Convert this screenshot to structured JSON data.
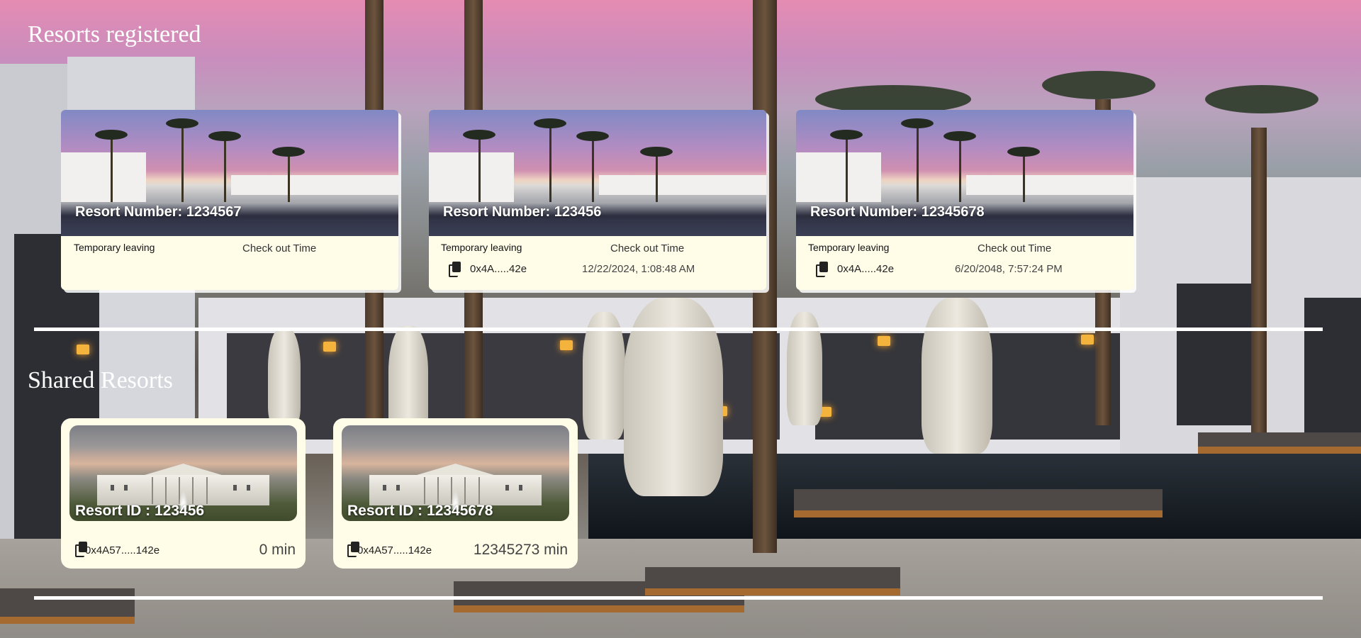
{
  "sections": {
    "registered_title": "Resorts registered",
    "shared_title": "Shared Resorts"
  },
  "registered": [
    {
      "title": "Resort Number: 1234567",
      "leaving_label": "Temporary leaving",
      "checkout_label": "Check out Time",
      "address": "",
      "checkout_time": ""
    },
    {
      "title": "Resort Number: 123456",
      "leaving_label": "Temporary leaving",
      "checkout_label": "Check out Time",
      "address": "0x4A.....42e",
      "checkout_time": "12/22/2024, 1:08:48 AM"
    },
    {
      "title": "Resort Number: 12345678",
      "leaving_label": "Temporary leaving",
      "checkout_label": "Check out Time",
      "address": "0x4A.....42e",
      "checkout_time": "6/20/2048, 7:57:24 PM"
    }
  ],
  "shared": [
    {
      "title": "Resort ID : 123456",
      "address": "0x4A57.....142e",
      "duration": "0 min"
    },
    {
      "title": "Resort ID : 12345678",
      "address": "0x4A57.....142e",
      "duration": "12345273 min"
    }
  ],
  "icons": {
    "copy": "copy-icon"
  }
}
